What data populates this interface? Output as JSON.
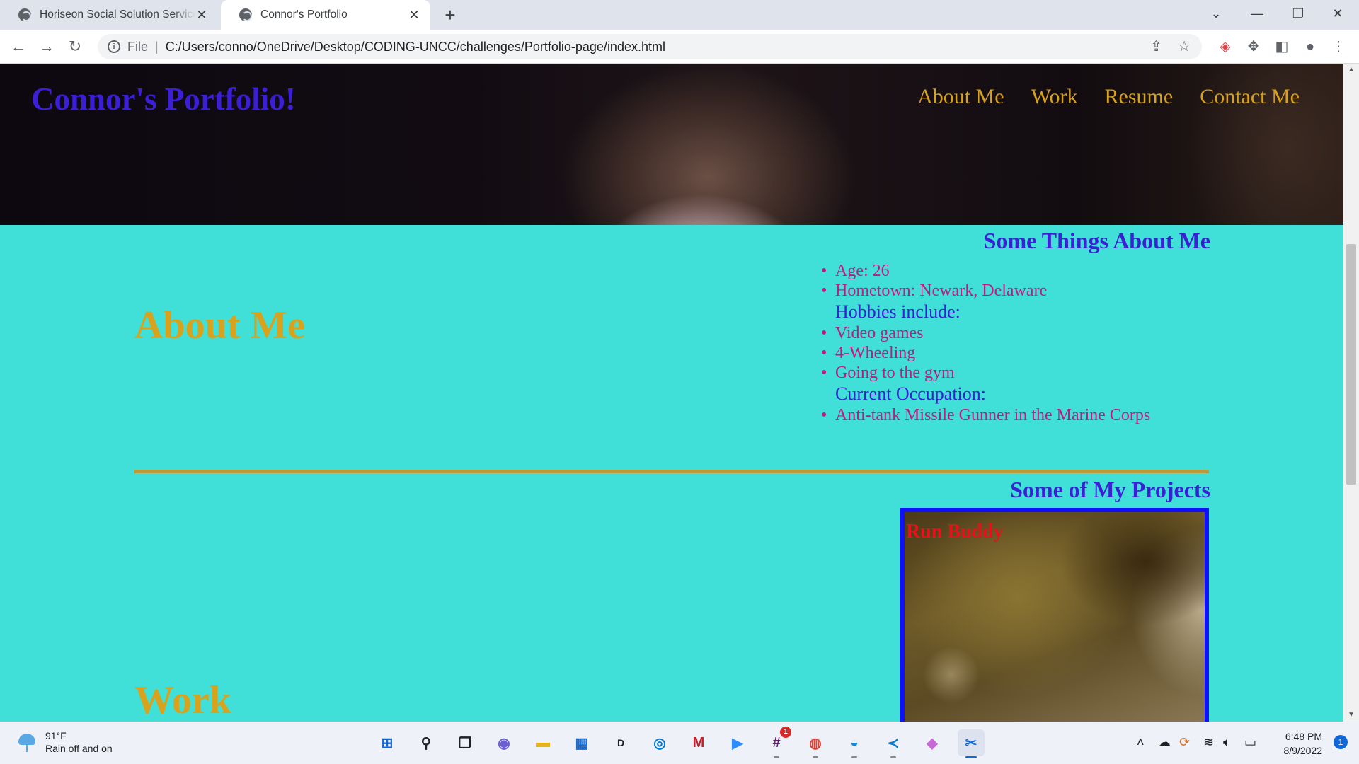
{
  "browser": {
    "tabs": [
      {
        "title": "Horiseon Social Solution Services",
        "active": false
      },
      {
        "title": "Connor's Portfolio",
        "active": true
      }
    ],
    "address": {
      "scheme": "File",
      "path": "C:/Users/conno/OneDrive/Desktop/CODING-UNCC/challenges/Portfolio-page/index.html"
    }
  },
  "page": {
    "logo": "Connor's Portfolio!",
    "nav": [
      "About Me",
      "Work",
      "Resume",
      "Contact Me"
    ],
    "about": {
      "heading": "About Me",
      "box_title": "Some Things About Me",
      "items": [
        {
          "text": "Age: 26",
          "group": false
        },
        {
          "text": "Hometown: Newark, Delaware",
          "group": false
        },
        {
          "text": "Hobbies include:",
          "group": true
        },
        {
          "text": "Video games",
          "group": false
        },
        {
          "text": "4-Wheeling",
          "group": false
        },
        {
          "text": "Going to the gym",
          "group": false
        },
        {
          "text": "Current Occupation:",
          "group": true
        },
        {
          "text": "Anti-tank Missile Gunner in the Marine Corps",
          "group": false
        }
      ]
    },
    "projects": {
      "heading": "Some of My Projects",
      "cards": [
        {
          "label": "Run Buddy"
        }
      ]
    },
    "work": {
      "heading": "Work"
    }
  },
  "taskbar": {
    "weather": {
      "temp": "91°F",
      "condition": "Rain off and on"
    },
    "apps": [
      {
        "name": "start-icon",
        "glyph": "⊞"
      },
      {
        "name": "search-icon",
        "glyph": "⚲"
      },
      {
        "name": "task-view-icon",
        "glyph": "❐"
      },
      {
        "name": "chat-icon",
        "glyph": "◉"
      },
      {
        "name": "file-explorer-icon",
        "glyph": "▬"
      },
      {
        "name": "microsoft-store-icon",
        "glyph": "▦"
      },
      {
        "name": "dell-icon",
        "glyph": "D"
      },
      {
        "name": "dell-support-icon",
        "glyph": "◎"
      },
      {
        "name": "mcafee-icon",
        "glyph": "M"
      },
      {
        "name": "zoom-icon",
        "glyph": "▶"
      },
      {
        "name": "slack-icon",
        "glyph": "#",
        "badge": "1"
      },
      {
        "name": "chrome-icon",
        "glyph": "◍"
      },
      {
        "name": "edge-icon",
        "glyph": "◒"
      },
      {
        "name": "vscode-icon",
        "glyph": "≺"
      },
      {
        "name": "git-icon",
        "glyph": "◆"
      },
      {
        "name": "snipping-tool-icon",
        "glyph": "✂",
        "active": true
      }
    ],
    "time": "6:48 PM",
    "date": "8/9/2022",
    "notifications": "1"
  },
  "colors": {
    "background": "#40e0d8",
    "logo": "#3a1fd6",
    "nav": "#d9a21d",
    "list_text": "#c2197e",
    "card_border": "#1010ff",
    "card_label": "#e8101a"
  }
}
